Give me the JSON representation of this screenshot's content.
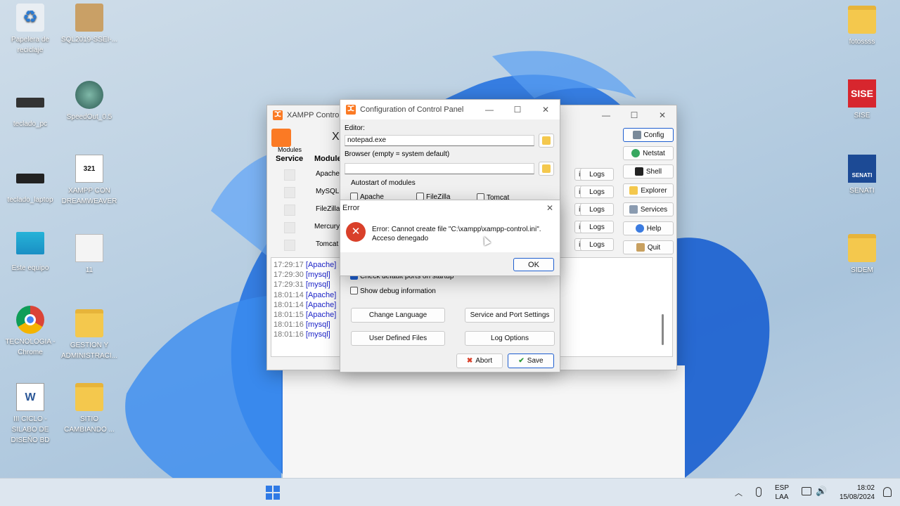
{
  "desktop": {
    "icons": [
      {
        "label": "Papelera de reciclaje"
      },
      {
        "label": "SQL2019-SSEI-..."
      },
      {
        "label": "teclado_pc"
      },
      {
        "label": "SpeedOut_0.5"
      },
      {
        "label": "teclado_laptop"
      },
      {
        "label": "XAMPP CON DREAMWEAVER"
      },
      {
        "label": "Este equipo"
      },
      {
        "label": "11"
      },
      {
        "label": "TECNOLOGIA - Chrome"
      },
      {
        "label": "GESTION Y ADMINISTRACI..."
      },
      {
        "label": "III CICLO - SILABO DE DISEÑO BD"
      },
      {
        "label": "SITIO CAMBIANDO ..."
      },
      {
        "label": "fotossss"
      },
      {
        "label": "SISE"
      },
      {
        "label": "SENATI"
      },
      {
        "label": "SIDEM"
      }
    ],
    "sise_logo": "SISE",
    "senati_logo": "SENATI",
    "calendar_number": "321"
  },
  "xampp": {
    "title": "XAMPP Control P",
    "header_partial": "X",
    "modules_label": "Modules",
    "col_service": "Service",
    "col_module": "Module",
    "modules": [
      "Apache",
      "MySQL",
      "FileZilla",
      "Mercury",
      "Tomcat"
    ],
    "config_partial": "ig",
    "logs_label": "Logs",
    "side_buttons": [
      "Config",
      "Netstat",
      "Shell",
      "Explorer",
      "Services",
      "Help",
      "Quit"
    ],
    "log_lines": [
      {
        "time": "17:29:17",
        "tag": "[Apache]"
      },
      {
        "time": "17:29:30",
        "tag": "[mysql]"
      },
      {
        "time": "17:29:31",
        "tag": "[mysql]"
      },
      {
        "time": "18:01:14",
        "tag": "[Apache]"
      },
      {
        "time": "18:01:14",
        "tag": "[Apache]"
      },
      {
        "time": "18:01:15",
        "tag": "[Apache]"
      },
      {
        "time": "18:01:16",
        "tag": "[mysql]"
      },
      {
        "time": "18:01:16",
        "tag": "[mysql]"
      }
    ]
  },
  "config_dialog": {
    "title": "Configuration of Control Panel",
    "editor_label": "Editor:",
    "editor_value": "notepad.exe",
    "browser_label": "Browser (empty = system default)",
    "browser_value": "",
    "autostart_label": "Autostart of modules",
    "autostart": [
      "Apache",
      "FileZilla",
      "Tomcat"
    ],
    "check_ports_partial": "Check default ports on startup",
    "show_debug": "Show debug information",
    "btn_change_language": "Change Language",
    "btn_service_port": "Service and Port Settings",
    "btn_user_files": "User Defined Files",
    "btn_log_options": "Log Options",
    "btn_abort": "Abort",
    "btn_save": "Save"
  },
  "error_dialog": {
    "title": "Error",
    "message_line1": "Error: Cannot create file \"C:\\xampp\\xampp-control.ini\".",
    "message_line2": "Acceso denegado",
    "ok": "OK"
  },
  "taskbar": {
    "lang_line1": "ESP",
    "lang_line2": "LAA",
    "time": "18:02",
    "date": "15/08/2024"
  },
  "colors": {
    "xampp_orange": "#fb7a24",
    "log_blue": "#1d24c9",
    "error_red": "#d9402a",
    "accent_blue": "#1e5ecf"
  }
}
